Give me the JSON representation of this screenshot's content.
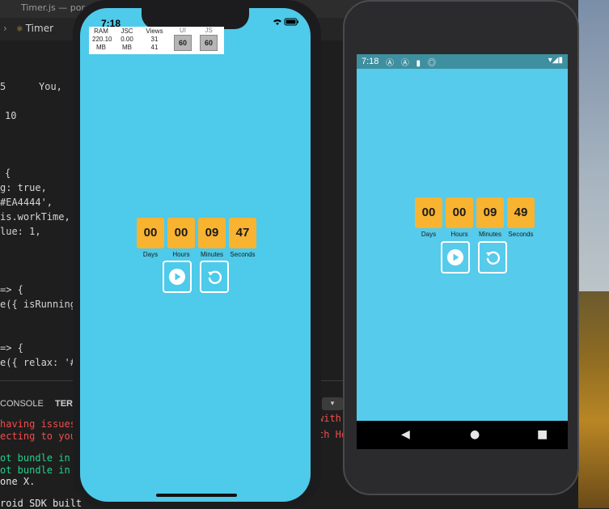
{
  "window": {
    "title": "Timer.js — por"
  },
  "editor_tab": {
    "label": "Timer",
    "icon": "react-js-icon"
  },
  "code_lines": [
    {
      "text": "5",
      "color": "#8a8a8a"
    },
    {
      "text": "You,",
      "color": "#6a6a6a"
    },
    {
      "text": "10",
      "color": "#7fb6e0"
    },
    {
      "text": "{",
      "color": "#d4d4d4"
    },
    {
      "text": "g: true,",
      "color": "#d4d4d4"
    },
    {
      "text": "#EA4444',",
      "color": "#ce9178"
    },
    {
      "text": "is.workTime,",
      "color": "#d4d4d4"
    },
    {
      "text": "lue: 1,",
      "color": "#d4d4d4"
    },
    {
      "text": "=> {",
      "color": "#c586c0"
    },
    {
      "text": "e({ isRunning",
      "color": "#d4d4d4"
    },
    {
      "text": "=> {",
      "color": "#c586c0"
    },
    {
      "text": "e({ relax: '#",
      "color": "#d4d4d4"
    }
  ],
  "panel": {
    "tabs": [
      "CONSOLE",
      "TER"
    ],
    "lines": [
      {
        "text": "having issues",
        "color": "#f14c4c"
      },
      {
        "text": "ecting to you",
        "color": "#f14c4c"
      },
      {
        "text": "ot bundle in",
        "color": "#23d18b"
      },
      {
        "text": "ot bundle in",
        "color": "#23d18b"
      },
      {
        "text": "one X.",
        "color": "#e5e5e5"
      },
      {
        "text": "roid SDK built",
        "color": "#e5e5e5"
      }
    ],
    "right_lines": [
      "with",
      "ch Ho"
    ]
  },
  "ios": {
    "time": "7:18",
    "perf": {
      "ram_label": "RAM",
      "ram_value": "220.10",
      "ram_unit": "MB",
      "jsc_label": "JSC",
      "jsc_value": "0.00",
      "jsc_unit": "MB",
      "views_label": "Views",
      "views_a": "31",
      "views_b": "41",
      "ui_label": "UI",
      "ui_fps": "60",
      "js_label": "JS",
      "js_fps": "60"
    },
    "timer": {
      "days": "00",
      "hours": "00",
      "minutes": "09",
      "seconds": "47"
    }
  },
  "android": {
    "time": "7:18",
    "timer": {
      "days": "00",
      "hours": "00",
      "minutes": "09",
      "seconds": "49"
    }
  },
  "labels": {
    "days": "Days",
    "hours": "Hours",
    "minutes": "Minutes",
    "seconds": "Seconds"
  },
  "colors": {
    "screen_ios": "#4ecaea",
    "screen_android": "#56cbeb",
    "tile": "#f8b330",
    "android_status": "#3e8f9f"
  }
}
